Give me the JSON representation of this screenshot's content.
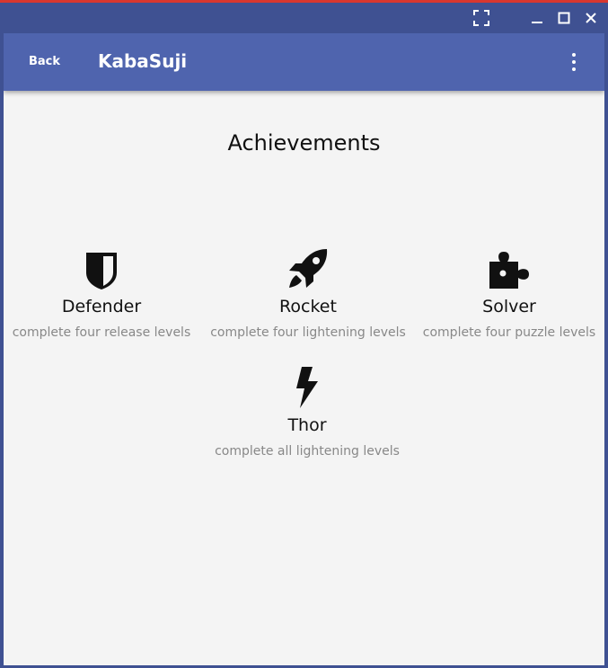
{
  "window": {
    "controls": {
      "fullscreen": "fullscreen-icon",
      "minimize": "minimize-icon",
      "maximize": "maximize-icon",
      "close": "close-icon"
    },
    "colors": {
      "frame": "#3f5192",
      "accent_top": "#d9372f"
    }
  },
  "appbar": {
    "back_label": "Back",
    "title": "KabaSuji",
    "menu_icon": "more-vert-icon",
    "color": "#4f64ae"
  },
  "page": {
    "title": "Achievements"
  },
  "achievements": [
    {
      "icon": "shield-icon",
      "name": "Defender",
      "description": "complete four release levels"
    },
    {
      "icon": "rocket-icon",
      "name": "Rocket",
      "description": "complete four lightening levels"
    },
    {
      "icon": "puzzle-icon",
      "name": "Solver",
      "description": "complete four puzzle levels"
    },
    {
      "icon": "lightning-icon",
      "name": "Thor",
      "description": "complete all lightening levels"
    }
  ]
}
